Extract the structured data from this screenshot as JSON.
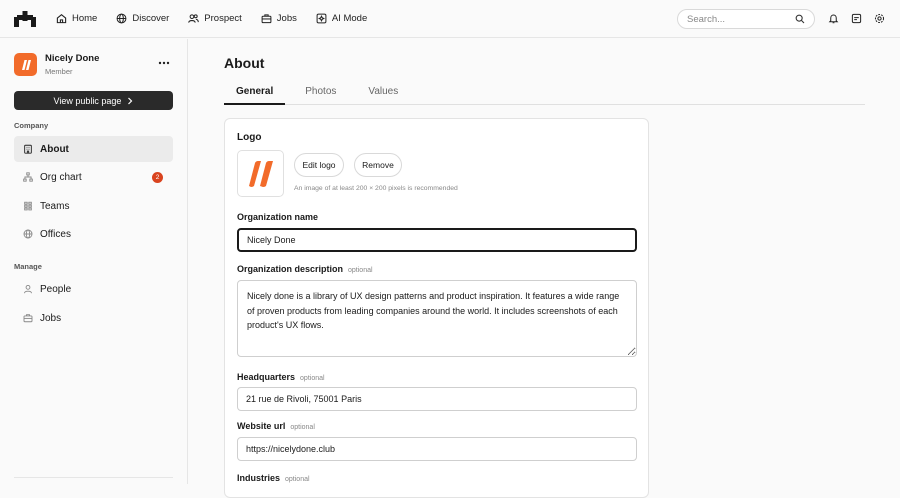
{
  "nav": {
    "items": [
      {
        "label": "Home",
        "icon": "home-icon"
      },
      {
        "label": "Discover",
        "icon": "globe-icon"
      },
      {
        "label": "Prospect",
        "icon": "users-icon"
      },
      {
        "label": "Jobs",
        "icon": "briefcase-icon"
      },
      {
        "label": "AI Mode",
        "icon": "sparkle-icon"
      }
    ],
    "search_placeholder": "Search...",
    "right_icons": [
      "bell-icon",
      "message-icon",
      "settings-icon"
    ]
  },
  "sidebar": {
    "company_name": "Nicely Done",
    "role": "Member",
    "view_public_label": "View public page",
    "company_section": "Company",
    "company_items": [
      {
        "label": "About",
        "icon": "building-icon",
        "active": true
      },
      {
        "label": "Org chart",
        "icon": "org-chart-icon",
        "badge": "2"
      },
      {
        "label": "Teams",
        "icon": "teams-icon"
      },
      {
        "label": "Offices",
        "icon": "globe-icon"
      }
    ],
    "manage_section": "Manage",
    "manage_items": [
      {
        "label": "People",
        "icon": "person-icon"
      },
      {
        "label": "Jobs",
        "icon": "briefcase-icon"
      }
    ]
  },
  "main": {
    "title": "About",
    "tabs": [
      {
        "label": "General",
        "active": true
      },
      {
        "label": "Photos"
      },
      {
        "label": "Values"
      }
    ],
    "form": {
      "logo_label": "Logo",
      "edit_logo_label": "Edit logo",
      "remove_label": "Remove",
      "logo_hint": "An image of at least 200 × 200 pixels is recommended",
      "org_name_label": "Organization name",
      "org_name_value": "Nicely Done",
      "org_desc_label": "Organization description",
      "optional_label": "optional",
      "org_desc_value": "Nicely done is a library of UX design patterns and product inspiration. It features a wide range of proven products from leading companies around the world. It includes screenshots of each product's UX flows.",
      "hq_label": "Headquarters",
      "hq_value": "21 rue de Rivoli, 75001 Paris",
      "website_label": "Website url",
      "website_value": "https://nicelydone.club",
      "industries_label": "Industries"
    }
  },
  "colors": {
    "brand_orange": "#f26b2a",
    "badge_red": "#d9431e",
    "dark_button": "#2a2a2a"
  }
}
